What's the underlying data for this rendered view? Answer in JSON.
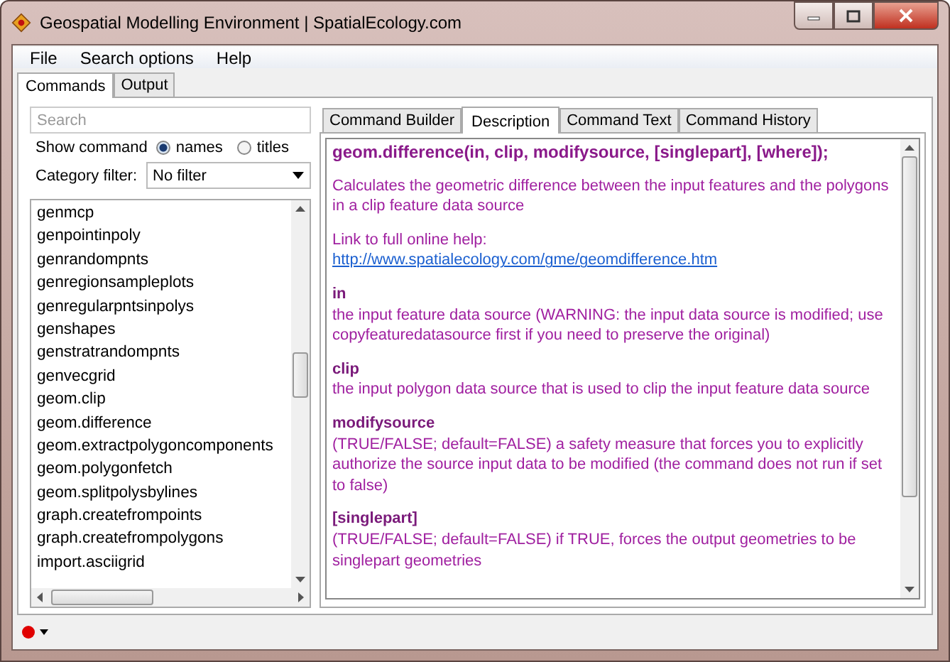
{
  "window": {
    "title": "Geospatial Modelling Environment | SpatialEcology.com"
  },
  "menu": [
    "File",
    "Search options",
    "Help"
  ],
  "main_tabs": [
    {
      "label": "Commands",
      "selected": true
    },
    {
      "label": "Output",
      "selected": false
    }
  ],
  "search": {
    "placeholder": "Search"
  },
  "show_command": {
    "label": "Show command",
    "options": [
      {
        "label": "names",
        "selected": true
      },
      {
        "label": "titles",
        "selected": false
      }
    ]
  },
  "category_filter": {
    "label": "Category filter:",
    "value": "No filter"
  },
  "commands": [
    "genmcp",
    "genpointinpoly",
    "genrandompnts",
    "genregionsampleplots",
    "genregularpntsinpolys",
    "genshapes",
    "genstratrandompnts",
    "genvecgrid",
    "geom.clip",
    "geom.difference",
    "geom.extractpolygoncomponents",
    "geom.polygonfetch",
    "geom.splitpolysbylines",
    "graph.createfrompoints",
    "graph.createfrompolygons",
    "import.asciigrid"
  ],
  "detail_tabs": [
    {
      "label": "Command Builder",
      "selected": false
    },
    {
      "label": "Description",
      "selected": true
    },
    {
      "label": "Command Text",
      "selected": false
    },
    {
      "label": "Command History",
      "selected": false
    }
  ],
  "description": {
    "signature": "geom.difference(in, clip, modifysource, [singlepart], [where]);",
    "summary": "Calculates the geometric difference between the input features and the polygons in a clip feature data source",
    "link_label": "Link to full online help:",
    "link": "http://www.spatialecology.com/gme/geomdifference.htm",
    "parameters": [
      {
        "name": "in",
        "text": "the input feature data source (WARNING: the input data source is modified; use copyfeaturedatasource first if you need to preserve the original)"
      },
      {
        "name": "clip",
        "text": "the input polygon data source that is used to clip the input feature data source"
      },
      {
        "name": "modifysource",
        "text": "(TRUE/FALSE; default=FALSE) a safety measure that forces you to explicitly authorize the source input data to be modified (the command does not run if set to false)"
      },
      {
        "name": "[singlepart]",
        "text": "(TRUE/FALSE; default=FALSE) if TRUE, forces the output geometries to be singlepart geometries"
      }
    ]
  }
}
